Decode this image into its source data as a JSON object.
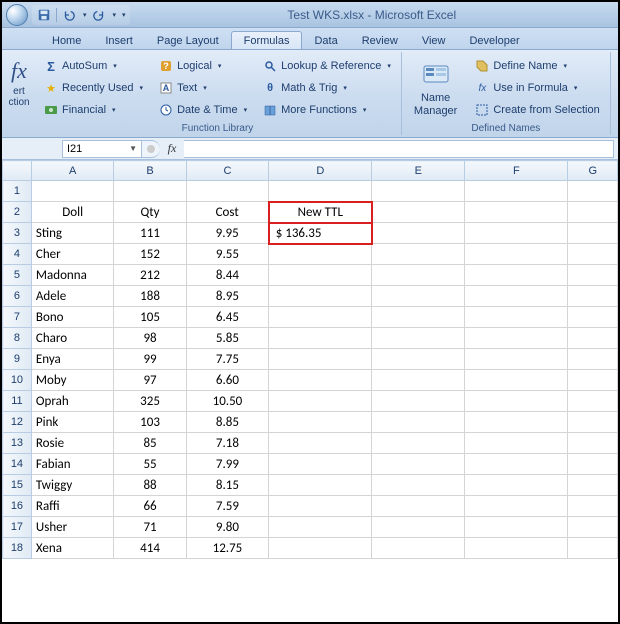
{
  "title": "Test WKS.xlsx - Microsoft Excel",
  "tabs": {
    "home": "Home",
    "insert": "Insert",
    "pagelayout": "Page Layout",
    "formulas": "Formulas",
    "data": "Data",
    "review": "Review",
    "view": "View",
    "developer": "Developer"
  },
  "ribbon": {
    "insertfn_1": "ert",
    "insertfn_2": "ction",
    "autosum": "AutoSum",
    "recent": "Recently Used",
    "financial": "Financial",
    "logical": "Logical",
    "text": "Text",
    "datetime": "Date & Time",
    "lookup": "Lookup & Reference",
    "math": "Math & Trig",
    "more": "More Functions",
    "group_funclib": "Function Library",
    "namemgr": "Name\nManager",
    "defname": "Define Name",
    "useinf": "Use in Formula",
    "createsel": "Create from Selection",
    "group_defnames": "Defined Names"
  },
  "namebox": "I21",
  "formula": "",
  "columns": [
    "A",
    "B",
    "C",
    "D",
    "E",
    "F",
    "G"
  ],
  "row_numbers": [
    "1",
    "2",
    "3",
    "4",
    "5",
    "6",
    "7",
    "8",
    "9",
    "10",
    "11",
    "12",
    "13",
    "14",
    "15",
    "16",
    "17",
    "18"
  ],
  "headers": {
    "doll": "Doll",
    "qty": "Qty",
    "cost": "Cost",
    "newttl": "New TTL"
  },
  "highlight_value": "$    136.35",
  "rows": [
    {
      "doll": "Sting",
      "qty": "111",
      "cost": "9.95"
    },
    {
      "doll": "Cher",
      "qty": "152",
      "cost": "9.55"
    },
    {
      "doll": "Madonna",
      "qty": "212",
      "cost": "8.44"
    },
    {
      "doll": "Adele",
      "qty": "188",
      "cost": "8.95"
    },
    {
      "doll": "Bono",
      "qty": "105",
      "cost": "6.45"
    },
    {
      "doll": "Charo",
      "qty": "98",
      "cost": "5.85"
    },
    {
      "doll": "Enya",
      "qty": "99",
      "cost": "7.75"
    },
    {
      "doll": "Moby",
      "qty": "97",
      "cost": "6.60"
    },
    {
      "doll": "Oprah",
      "qty": "325",
      "cost": "10.50"
    },
    {
      "doll": "Pink",
      "qty": "103",
      "cost": "8.85"
    },
    {
      "doll": "Rosie",
      "qty": "85",
      "cost": "7.18"
    },
    {
      "doll": "Fabian",
      "qty": "55",
      "cost": "7.99"
    },
    {
      "doll": "Twiggy",
      "qty": "88",
      "cost": "8.15"
    },
    {
      "doll": "Raffi",
      "qty": "66",
      "cost": "7.59"
    },
    {
      "doll": "Usher",
      "qty": "71",
      "cost": "9.80"
    },
    {
      "doll": "Xena",
      "qty": "414",
      "cost": "12.75"
    }
  ]
}
